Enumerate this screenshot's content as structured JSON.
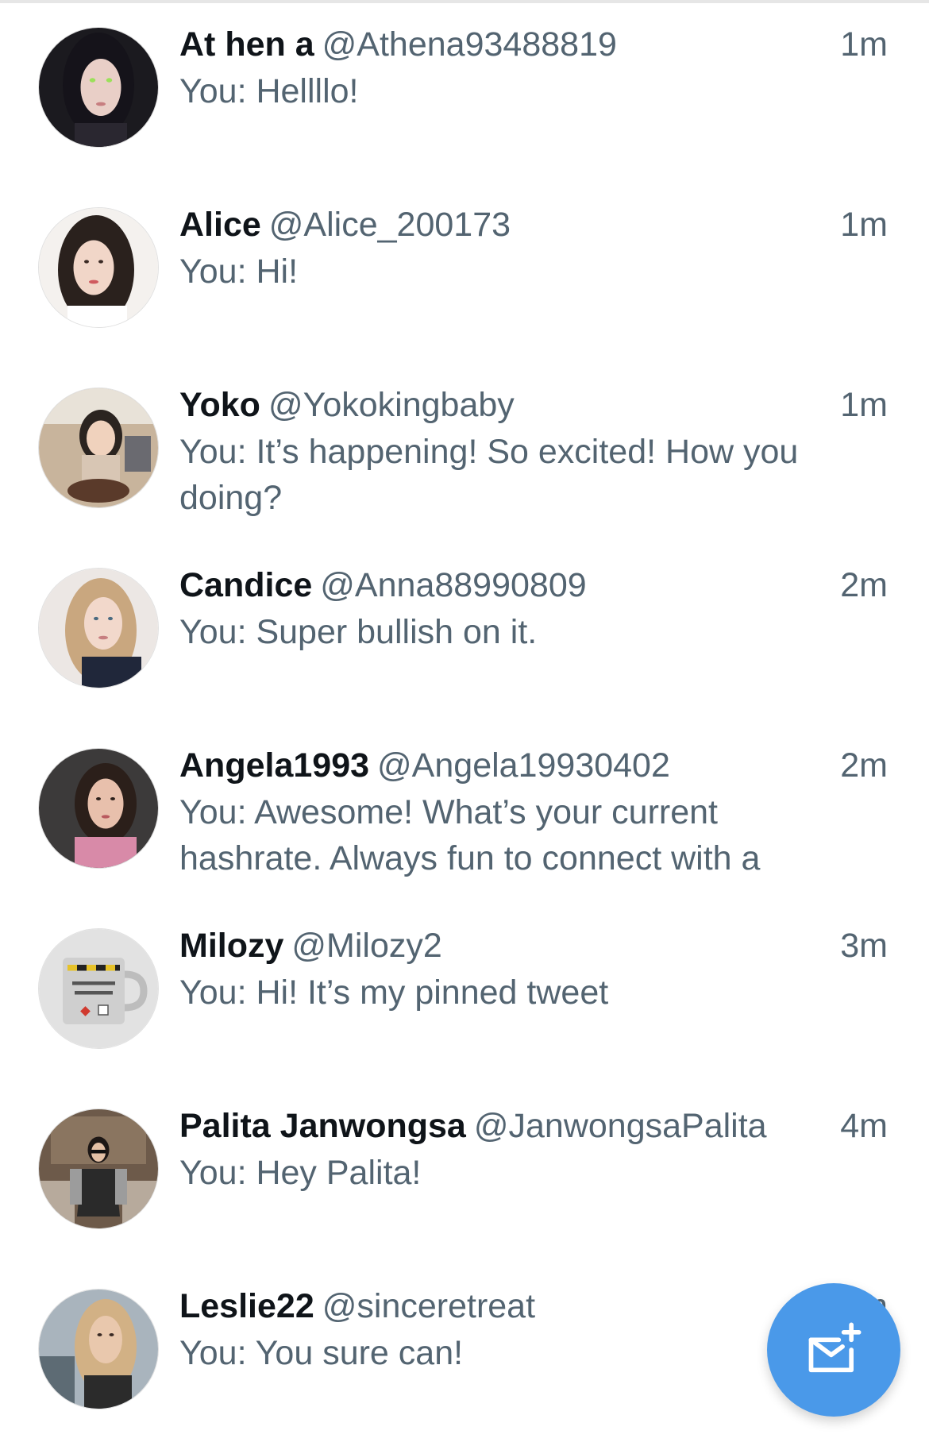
{
  "conversations": [
    {
      "name": "At hen a",
      "handle": "@Athena93488819",
      "time": "1m",
      "preview": "You: Hellllo!",
      "avatar_icon": "profile-photo-athena",
      "avatar_bg": "#1b1a1f",
      "avatar_skin": "#e9cfc7",
      "avatar_hair": "#15131a"
    },
    {
      "name": "Alice",
      "handle": "@Alice_200173",
      "time": "1m",
      "preview": "You: Hi!",
      "avatar_icon": "profile-photo-alice",
      "avatar_bg": "#f4f1ee",
      "avatar_skin": "#f1d6c8",
      "avatar_hair": "#2a211d"
    },
    {
      "name": "Yoko",
      "handle": "@Yokokingbaby",
      "time": "1m",
      "preview": "You: It’s happening! So excited! How you doing?",
      "avatar_icon": "profile-photo-yoko",
      "avatar_bg": "#c8b49c",
      "avatar_skin": "#f0d2bd",
      "avatar_hair": "#2b2420"
    },
    {
      "name": "Candice",
      "handle": "@Anna88990809",
      "time": "2m",
      "preview": "You: Super bullish on it.",
      "avatar_icon": "profile-photo-candice",
      "avatar_bg": "#ece7e4",
      "avatar_skin": "#f2d8cb",
      "avatar_hair": "#c9a77f"
    },
    {
      "name": "Angela1993",
      "handle": "@Angela19930402",
      "time": "2m",
      "preview": "You: Awesome! What’s your current hashrate. Always fun to connect with a",
      "avatar_icon": "profile-photo-angela",
      "avatar_bg": "#3c3a3a",
      "avatar_skin": "#e8c0ac",
      "avatar_hair": "#2b1f1a"
    },
    {
      "name": "Milozy",
      "handle": "@Milozy2",
      "time": "3m",
      "preview": "You: Hi! It’s my pinned tweet",
      "avatar_icon": "jet-fuel-mug-icon",
      "avatar_bg": "#e2e2e2",
      "avatar_skin": "#cfcfcf",
      "avatar_hair": "#9a9a9a"
    },
    {
      "name": "Palita Janwongsa",
      "handle": "@JanwongsaPalita",
      "time": "4m",
      "preview": "You: Hey Palita!",
      "avatar_icon": "profile-photo-palita",
      "avatar_bg": "#6d5a4a",
      "avatar_skin": "#e3c0a5",
      "avatar_hair": "#1d1715"
    },
    {
      "name": "Leslie22",
      "handle": "@sinceretreat",
      "time": "5m",
      "preview": "You: You sure can!",
      "avatar_icon": "profile-photo-leslie",
      "avatar_bg": "#a9b4bd",
      "avatar_skin": "#e9c8ad",
      "avatar_hair": "#d2b185"
    }
  ],
  "fab": {
    "icon": "new-message-icon",
    "color": "#4a99e9"
  }
}
